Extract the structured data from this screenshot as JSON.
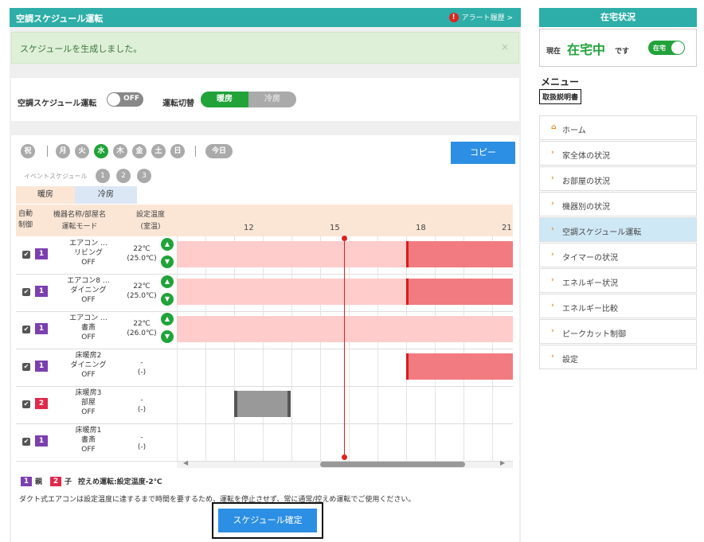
{
  "header": {
    "title": "空調スケジュール運転",
    "alert_icon": "!",
    "alert_label": "アラート履歴 >"
  },
  "message": {
    "text": "スケジュールを生成しました。",
    "close": "×"
  },
  "controls": {
    "schedule_label": "空調スケジュール運転",
    "schedule_toggle": "OFF",
    "mode_label": "運転切替",
    "mode_options": [
      "暖房",
      "冷房"
    ]
  },
  "days": [
    "祝",
    "月",
    "火",
    "水",
    "木",
    "金",
    "土",
    "日",
    "今日"
  ],
  "event_label": "イベントスケジュール",
  "events": [
    "1",
    "2",
    "3"
  ],
  "copy_label": "コピー",
  "tabs": [
    "暖房",
    "冷房"
  ],
  "table_header": {
    "auto": "自動制御",
    "device": "機器名称/部屋名",
    "mode": "運転モード",
    "setting": "設定温度",
    "room": "(室温)",
    "ticks": [
      "12",
      "15",
      "18",
      "21"
    ]
  },
  "rows": [
    {
      "check": "✔",
      "home": "1",
      "home_type": "親",
      "name1": "エアコン …",
      "name2": "リビング",
      "name3": "OFF",
      "set": "22℃",
      "room": "(25.0℃)"
    },
    {
      "check": "✔",
      "home": "1",
      "home_type": "親",
      "name1": "エアコン8 …",
      "name2": "ダイニング",
      "name3": "OFF",
      "set": "22℃",
      "room": "(25.0℃)"
    },
    {
      "check": "✔",
      "home": "1",
      "home_type": "親",
      "name1": "エアコン …",
      "name2": "書斎",
      "name3": "OFF",
      "set": "22℃",
      "room": "(26.0℃)"
    },
    {
      "check": "✔",
      "home": "1",
      "home_type": "親",
      "name1": "床暖房2",
      "name2": "ダイニング",
      "name3": "OFF",
      "set": "-",
      "room": "(-)"
    },
    {
      "check": "✔",
      "home": "2",
      "home_type": "子",
      "name1": "床暖房3",
      "name2": "部屋",
      "name3": "OFF",
      "set": "-",
      "room": "(-)"
    },
    {
      "check": "✔",
      "home": "1",
      "home_type": "親",
      "name1": "床暖房1",
      "name2": "書斎",
      "name3": "OFF",
      "set": "-",
      "room": "(-)"
    }
  ],
  "legend": {
    "parent_num": "1",
    "parent": "親",
    "child_num": "2",
    "child": "子",
    "note": "控えめ運転:設定温度-2℃"
  },
  "footer_note": "ダクト式エアコンは設定温度に達するまで時間を要するため、運転を停止させず、常に通常/控えめ運転でご使用ください。",
  "confirm_label": "スケジュール確定",
  "sidebar": {
    "title": "在宅状況",
    "status_prefix": "現在",
    "status": "在宅中",
    "status_suffix": "です",
    "toggle": "在宅",
    "menu_title": "メニュー",
    "manual": "取扱説明書",
    "items": [
      "ホーム",
      "家全体の状況",
      "お部屋の状況",
      "機器別の状況",
      "空調スケジュール運転",
      "タイマーの状況",
      "エネルギー状況",
      "エネルギー比較",
      "ピークカット制御",
      "設定"
    ],
    "selected": "空調スケジュール運転"
  },
  "colors": {
    "teal": "#2eaea8",
    "green": "#21a33a",
    "pink": "#ffcccc",
    "red": "#f27b81",
    "blue": "#2d8fe3"
  }
}
